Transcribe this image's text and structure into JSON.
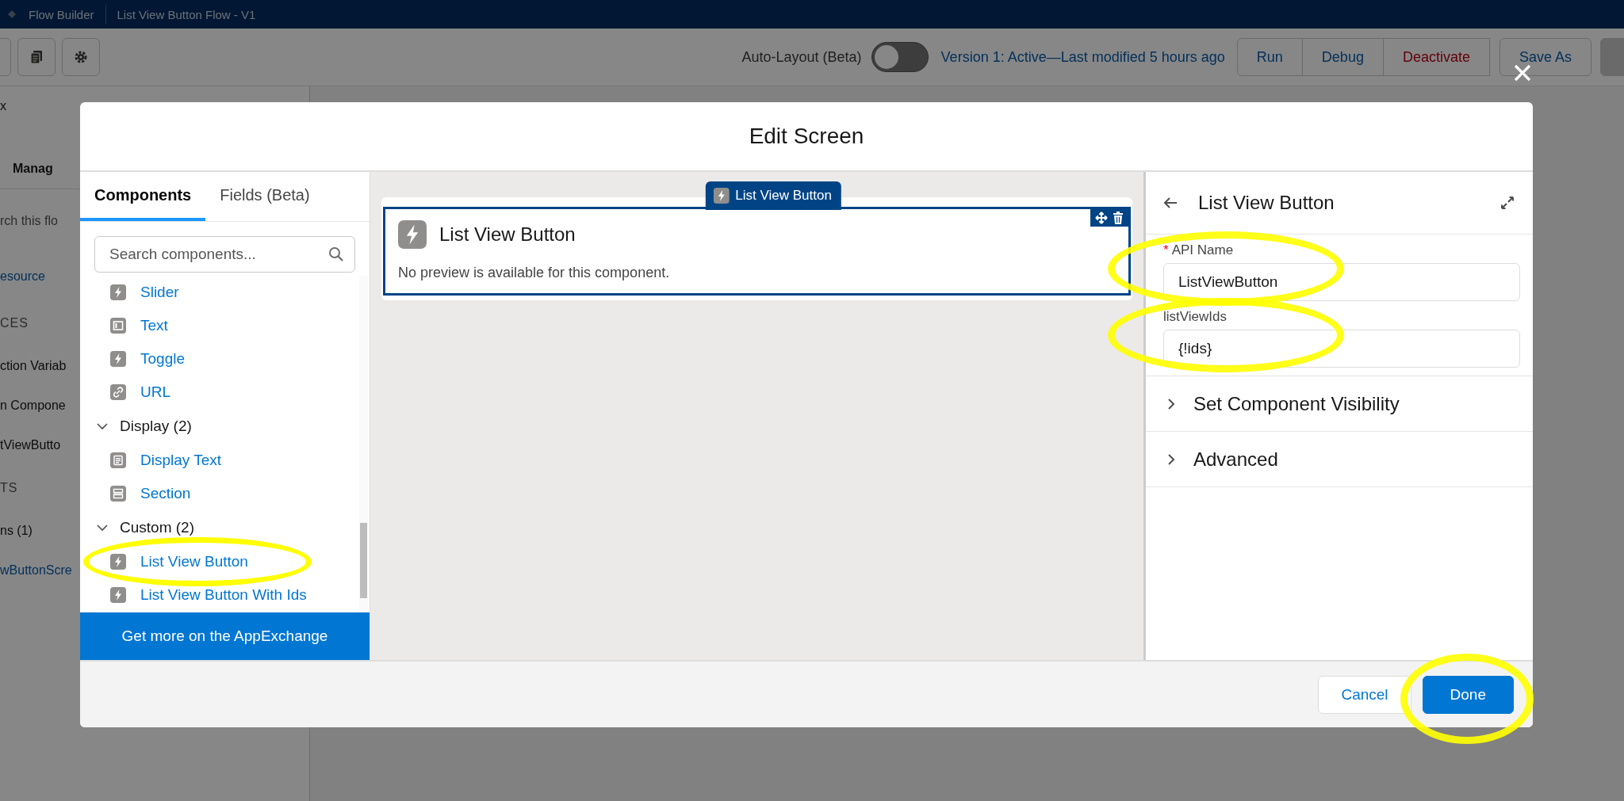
{
  "app_header": {
    "title": "Flow Builder",
    "flow_name": "List View Button Flow - V1"
  },
  "toolbar": {
    "auto_layout": {
      "label": "Auto-Layout (Beta)",
      "on": false
    },
    "version_status": "Version 1: Active—Last modified 5 hours ago",
    "actions": [
      {
        "label": "Run",
        "kind": "neutral"
      },
      {
        "label": "Debug",
        "kind": "neutral"
      },
      {
        "label": "Deactivate",
        "kind": "destructive"
      },
      {
        "label": "Save As",
        "kind": "neutral"
      }
    ]
  },
  "sidebar": [
    {
      "kind": "text",
      "label": "x"
    },
    {
      "kind": "tab",
      "label": "Manag"
    },
    {
      "kind": "search",
      "label": "rch this flo"
    },
    {
      "kind": "button",
      "label": "esource"
    },
    {
      "kind": "heading",
      "label": "CES"
    },
    {
      "kind": "text",
      "label": "ction Variab"
    },
    {
      "kind": "text",
      "label": "n Compone"
    },
    {
      "kind": "text",
      "label": "tViewButto"
    },
    {
      "kind": "heading",
      "label": "TS"
    },
    {
      "kind": "text",
      "label": "ns (1)"
    },
    {
      "kind": "link",
      "label": "wButtonScre"
    }
  ],
  "modal": {
    "title": "Edit Screen",
    "tabs": [
      {
        "label": "Components",
        "selected": true
      },
      {
        "label": "Fields (Beta)",
        "selected": false
      }
    ],
    "search": {
      "placeholder": "Search components..."
    },
    "component_list": [
      {
        "kind": "custom",
        "label": "Slider",
        "highlighted": false
      },
      {
        "kind": "text",
        "label": "Text",
        "highlighted": false
      },
      {
        "kind": "custom",
        "label": "Toggle",
        "highlighted": false
      },
      {
        "kind": "url",
        "label": "URL",
        "highlighted": false
      },
      {
        "kind": "group",
        "label": "Display (2)",
        "expanded": true,
        "children": [
          {
            "kind": "display_text",
            "label": "Display Text",
            "highlighted": false
          },
          {
            "kind": "section",
            "label": "Section",
            "highlighted": false
          }
        ]
      },
      {
        "kind": "group",
        "label": "Custom (2)",
        "expanded": true,
        "children": [
          {
            "kind": "custom",
            "label": "List View Button",
            "highlighted": true
          },
          {
            "kind": "custom",
            "label": "List View Button With Ids",
            "highlighted": false
          }
        ]
      }
    ],
    "appexchange_button": "Get more on the AppExchange",
    "canvas": {
      "component_tab": "List View Button",
      "card_title": "List View Button",
      "card_message": "No preview is available for this component.",
      "selected": true
    },
    "properties": {
      "title": "List View Button",
      "fields": [
        {
          "required_mark": "*",
          "label": "API Name",
          "value": "ListViewButton",
          "highlighted": true
        },
        {
          "label": "listViewIds",
          "value": "{!ids}",
          "highlighted": true
        }
      ],
      "sections": [
        {
          "label": "Set Component Visibility",
          "expanded": false
        },
        {
          "label": "Advanced",
          "expanded": false
        }
      ]
    },
    "footer_buttons": [
      {
        "label": "Cancel",
        "kind": "neutral",
        "highlighted": false
      },
      {
        "label": "Done",
        "kind": "brand",
        "highlighted": true
      }
    ]
  }
}
